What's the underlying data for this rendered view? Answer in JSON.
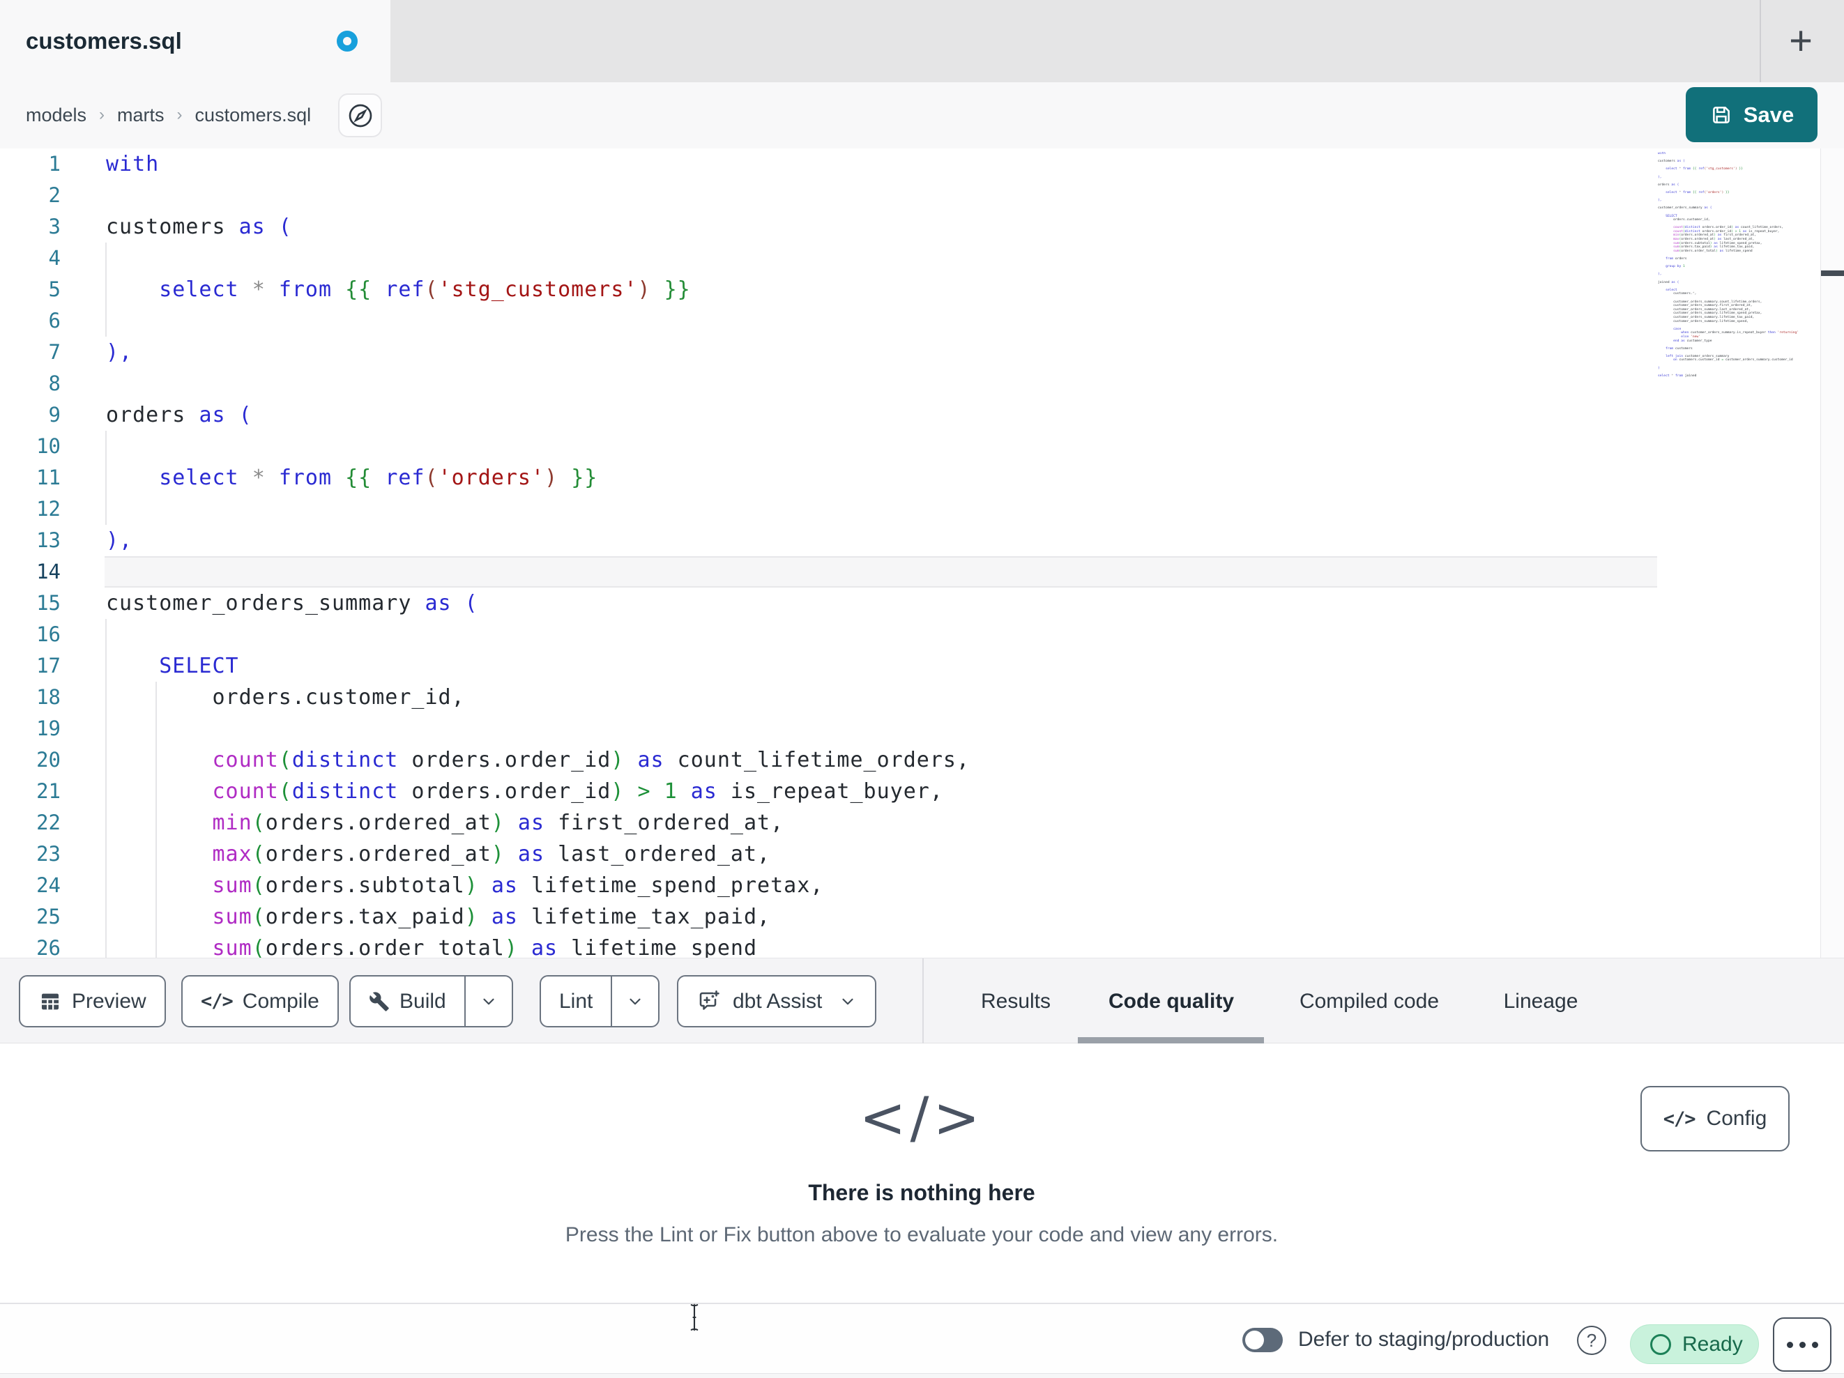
{
  "colors": {
    "accent_teal": "#11707a",
    "unsaved_dot_blue": "#18a0dc",
    "ready_bg": "#c9f2dc",
    "ready_text": "#17694b",
    "keyword_blue": "#2a2ad2",
    "function_magenta": "#b02cc4",
    "jinja_green": "#238c36",
    "string_red": "#a31515"
  },
  "tab_bar": {
    "active_tab": "customers.sql",
    "new_tab_label": "+"
  },
  "breadcrumb": {
    "items": [
      "models",
      "marts",
      "customers.sql"
    ],
    "separator": "›"
  },
  "header": {
    "save_label": "Save"
  },
  "editor": {
    "visible_lines": 26,
    "active_line": 14,
    "lines": [
      [
        [
          "k",
          "with"
        ]
      ],
      [],
      [
        [
          "i",
          "customers "
        ],
        [
          "k",
          "as ("
        ]
      ],
      [],
      [
        [
          "i",
          "    "
        ],
        [
          "k",
          "select"
        ],
        [
          "i",
          " "
        ],
        [
          "st",
          "*"
        ],
        [
          "i",
          " "
        ],
        [
          "k",
          "from"
        ],
        [
          "i",
          " "
        ],
        [
          "j",
          "{{"
        ],
        [
          "i",
          " "
        ],
        [
          "k",
          "ref"
        ],
        [
          "rp",
          "("
        ],
        [
          "s",
          "'stg_customers'"
        ],
        [
          "rp",
          ")"
        ],
        [
          "i",
          " "
        ],
        [
          "j",
          "}}"
        ]
      ],
      [],
      [
        [
          "k",
          "),"
        ]
      ],
      [],
      [
        [
          "i",
          "orders "
        ],
        [
          "k",
          "as ("
        ]
      ],
      [],
      [
        [
          "i",
          "    "
        ],
        [
          "k",
          "select"
        ],
        [
          "i",
          " "
        ],
        [
          "st",
          "*"
        ],
        [
          "i",
          " "
        ],
        [
          "k",
          "from"
        ],
        [
          "i",
          " "
        ],
        [
          "j",
          "{{"
        ],
        [
          "i",
          " "
        ],
        [
          "k",
          "ref"
        ],
        [
          "rp",
          "("
        ],
        [
          "s",
          "'orders'"
        ],
        [
          "rp",
          ")"
        ],
        [
          "i",
          " "
        ],
        [
          "j",
          "}}"
        ]
      ],
      [],
      [
        [
          "k",
          "),"
        ]
      ],
      [],
      [
        [
          "i",
          "customer_orders_summary "
        ],
        [
          "k",
          "as ("
        ]
      ],
      [],
      [
        [
          "i",
          "    "
        ],
        [
          "k",
          "SELECT"
        ]
      ],
      [
        [
          "i",
          "        orders.customer_id,"
        ]
      ],
      [],
      [
        [
          "i",
          "        "
        ],
        [
          "f",
          "count"
        ],
        [
          "g",
          "("
        ],
        [
          "k",
          "distinct"
        ],
        [
          "i",
          " orders.order_id"
        ],
        [
          "g",
          ")"
        ],
        [
          "i",
          " "
        ],
        [
          "k",
          "as"
        ],
        [
          "i",
          " count_lifetime_orders,"
        ]
      ],
      [
        [
          "i",
          "        "
        ],
        [
          "f",
          "count"
        ],
        [
          "g",
          "("
        ],
        [
          "k",
          "distinct"
        ],
        [
          "i",
          " orders.order_id"
        ],
        [
          "g",
          ")"
        ],
        [
          "i",
          " "
        ],
        [
          "g",
          "> 1"
        ],
        [
          "i",
          " "
        ],
        [
          "k",
          "as"
        ],
        [
          "i",
          " is_repeat_buyer,"
        ]
      ],
      [
        [
          "i",
          "        "
        ],
        [
          "f",
          "min"
        ],
        [
          "g",
          "("
        ],
        [
          "i",
          "orders.ordered_at"
        ],
        [
          "g",
          ")"
        ],
        [
          "i",
          " "
        ],
        [
          "k",
          "as"
        ],
        [
          "i",
          " first_ordered_at,"
        ]
      ],
      [
        [
          "i",
          "        "
        ],
        [
          "f",
          "max"
        ],
        [
          "g",
          "("
        ],
        [
          "i",
          "orders.ordered_at"
        ],
        [
          "g",
          ")"
        ],
        [
          "i",
          " "
        ],
        [
          "k",
          "as"
        ],
        [
          "i",
          " last_ordered_at,"
        ]
      ],
      [
        [
          "i",
          "        "
        ],
        [
          "f",
          "sum"
        ],
        [
          "g",
          "("
        ],
        [
          "i",
          "orders.subtotal"
        ],
        [
          "g",
          ")"
        ],
        [
          "i",
          " "
        ],
        [
          "k",
          "as"
        ],
        [
          "i",
          " lifetime_spend_pretax,"
        ]
      ],
      [
        [
          "i",
          "        "
        ],
        [
          "f",
          "sum"
        ],
        [
          "g",
          "("
        ],
        [
          "i",
          "orders.tax_paid"
        ],
        [
          "g",
          ")"
        ],
        [
          "i",
          " "
        ],
        [
          "k",
          "as"
        ],
        [
          "i",
          " lifetime_tax_paid,"
        ]
      ],
      [
        [
          "i",
          "        "
        ],
        [
          "f",
          "sum"
        ],
        [
          "g",
          "("
        ],
        [
          "i",
          "orders.order_total"
        ],
        [
          "g",
          ")"
        ],
        [
          "i",
          " "
        ],
        [
          "k",
          "as"
        ],
        [
          "i",
          " lifetime_spend"
        ]
      ],
      [],
      [
        [
          "i",
          "    "
        ],
        [
          "k",
          "from"
        ],
        [
          "i",
          " orders"
        ]
      ],
      [],
      [
        [
          "i",
          "    "
        ],
        [
          "k",
          "group by"
        ],
        [
          "i",
          " "
        ],
        [
          "g",
          "1"
        ]
      ],
      [],
      [
        [
          "k",
          "),"
        ]
      ],
      [],
      [
        [
          "i",
          "joined "
        ],
        [
          "k",
          "as ("
        ]
      ],
      [],
      [
        [
          "i",
          "    "
        ],
        [
          "k",
          "select"
        ]
      ],
      [
        [
          "i",
          "        customers."
        ],
        [
          "st",
          "*"
        ],
        [
          "i",
          ","
        ]
      ],
      [],
      [
        [
          "i",
          "        customer_orders_summary.count_lifetime_orders,"
        ]
      ],
      [
        [
          "i",
          "        customer_orders_summary.first_ordered_at,"
        ]
      ],
      [
        [
          "i",
          "        customer_orders_summary.last_ordered_at,"
        ]
      ],
      [
        [
          "i",
          "        customer_orders_summary.lifetime_spend_pretax,"
        ]
      ],
      [
        [
          "i",
          "        customer_orders_summary.lifetime_tax_paid,"
        ]
      ],
      [
        [
          "i",
          "        customer_orders_summary.lifetime_spend,"
        ]
      ],
      [],
      [
        [
          "i",
          "        "
        ],
        [
          "k",
          "case"
        ]
      ],
      [
        [
          "i",
          "            "
        ],
        [
          "k",
          "when"
        ],
        [
          "i",
          " customer_orders_summary.is_repeat_buyer "
        ],
        [
          "k",
          "then"
        ],
        [
          "i",
          " "
        ],
        [
          "s",
          "'returning'"
        ]
      ],
      [
        [
          "i",
          "            "
        ],
        [
          "k",
          "else"
        ],
        [
          "i",
          " "
        ],
        [
          "s",
          "'new'"
        ]
      ],
      [
        [
          "i",
          "        "
        ],
        [
          "k",
          "end as"
        ],
        [
          "i",
          " customer_type"
        ]
      ],
      [],
      [
        [
          "i",
          "    "
        ],
        [
          "k",
          "from"
        ],
        [
          "i",
          " customers"
        ]
      ],
      [],
      [
        [
          "i",
          "    "
        ],
        [
          "k",
          "left join"
        ],
        [
          "i",
          " customer_orders_summary"
        ]
      ],
      [
        [
          "i",
          "        "
        ],
        [
          "k",
          "on"
        ],
        [
          "i",
          " customers.customer_id "
        ],
        [
          "g",
          "="
        ],
        [
          "i",
          " customer_orders_summary.customer_id"
        ]
      ],
      [],
      [
        [
          "k",
          ")"
        ]
      ],
      [],
      [
        [
          "k",
          "select"
        ],
        [
          "i",
          " "
        ],
        [
          "st",
          "*"
        ],
        [
          "i",
          " "
        ],
        [
          "k",
          "from"
        ],
        [
          "i",
          " joined"
        ]
      ]
    ]
  },
  "toolbar": {
    "buttons": [
      {
        "label": "Preview",
        "icon": "table-icon"
      },
      {
        "label": "Compile",
        "icon": "code-icon"
      },
      {
        "label": "Build",
        "icon": "wrench-icon",
        "has_dropdown": true
      },
      {
        "label": "Lint",
        "has_dropdown": true
      },
      {
        "label": "dbt Assist",
        "icon": "assist-icon",
        "has_dropdown": true
      }
    ],
    "tabs": [
      {
        "label": "Results",
        "active": false
      },
      {
        "label": "Code quality",
        "active": true
      },
      {
        "label": "Compiled code",
        "active": false
      },
      {
        "label": "Lineage",
        "active": false
      }
    ]
  },
  "results_panel": {
    "config_label": "Config",
    "empty_icon": "</>",
    "empty_title": "There is nothing here",
    "empty_subtitle": "Press the Lint or Fix button above to evaluate your code and view any errors."
  },
  "status_bar": {
    "defer_toggle_state": "off",
    "defer_label": "Defer to staging/production",
    "help_glyph": "?",
    "ready_label": "Ready"
  }
}
